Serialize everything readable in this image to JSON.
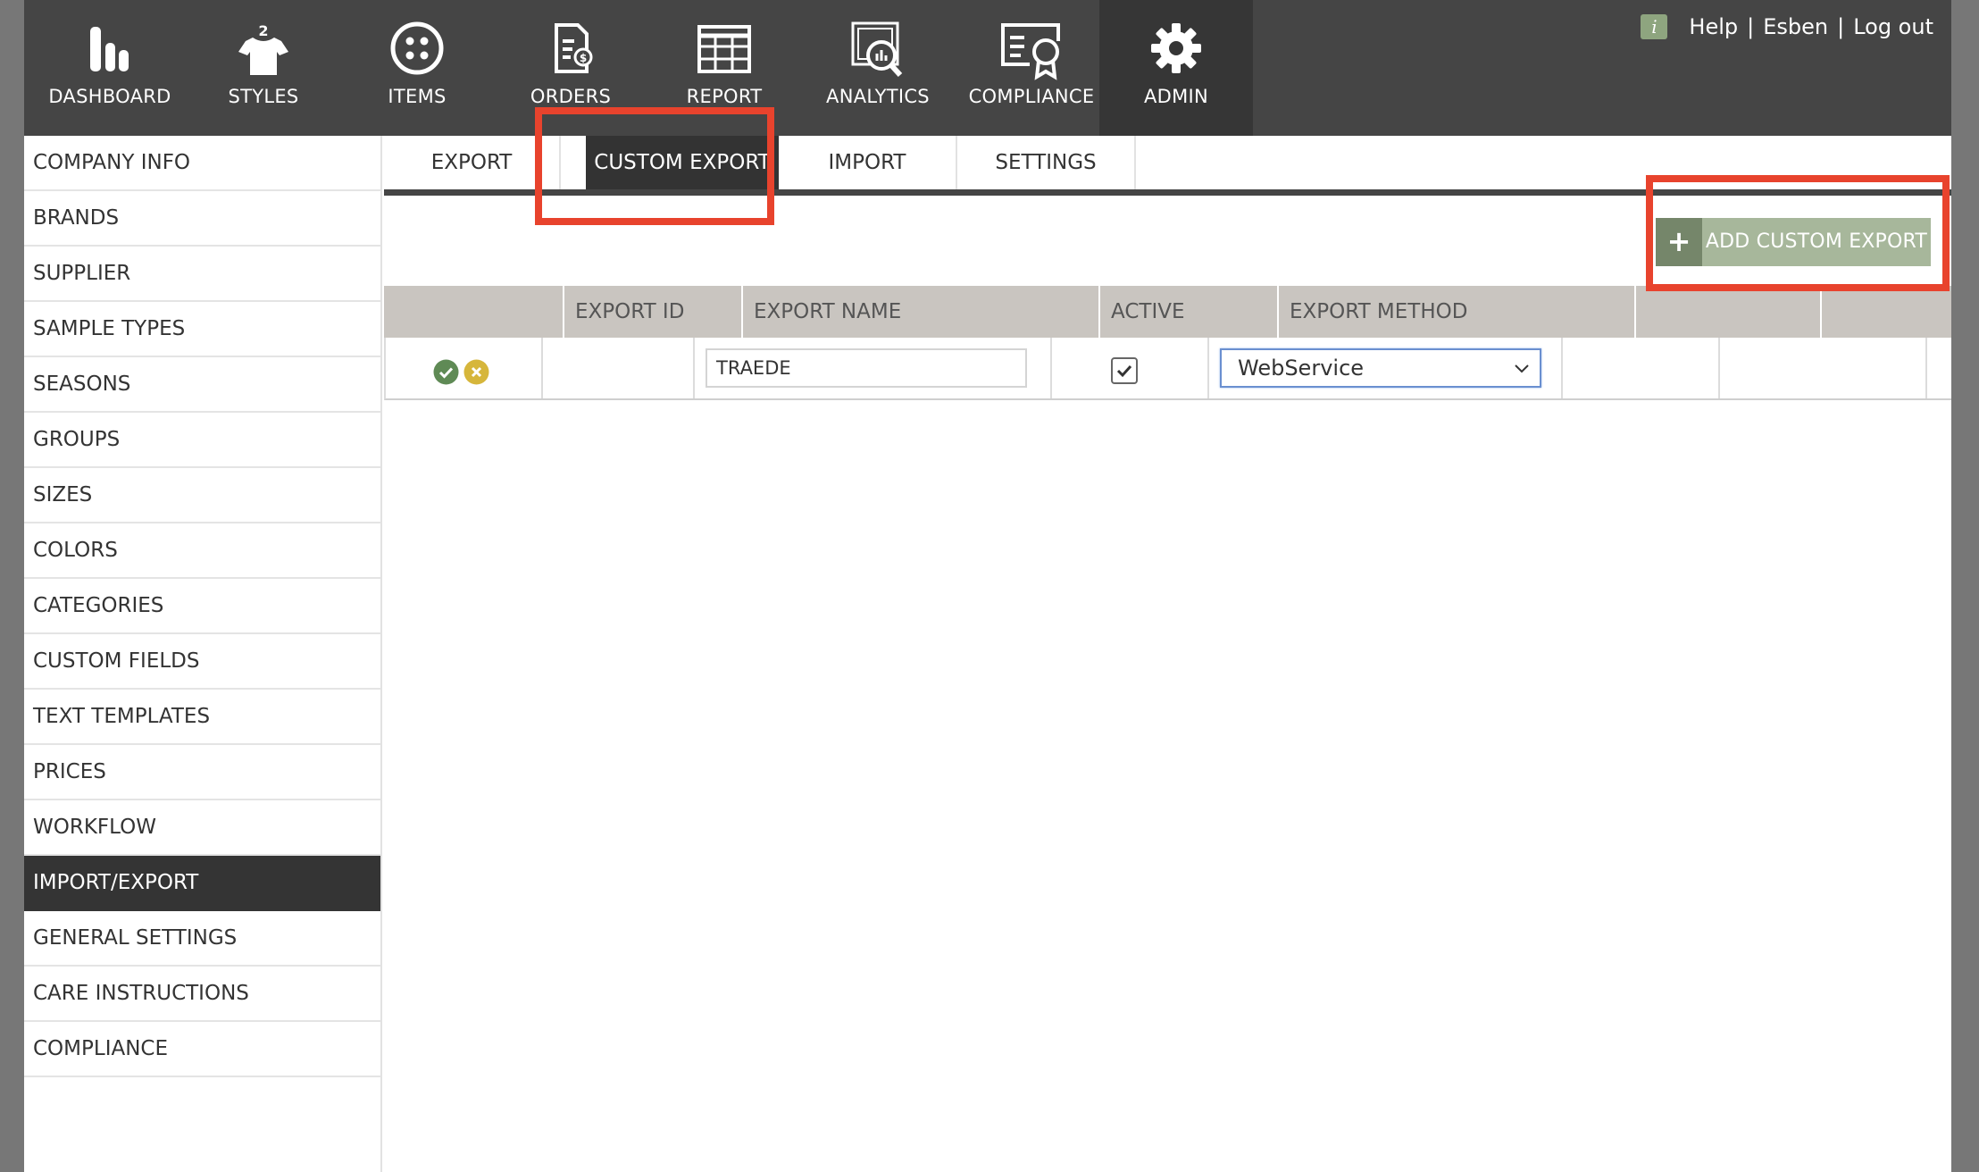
{
  "nav": {
    "items": [
      {
        "label": "DASHBOARD",
        "icon": "bar-chart-icon"
      },
      {
        "label": "STYLES",
        "icon": "tshirt-icon"
      },
      {
        "label": "ITEMS",
        "icon": "button-icon"
      },
      {
        "label": "ORDERS",
        "icon": "invoice-icon"
      },
      {
        "label": "REPORT",
        "icon": "table-grid-icon"
      },
      {
        "label": "ANALYTICS",
        "icon": "magnifier-chart-icon"
      },
      {
        "label": "COMPLIANCE",
        "icon": "certificate-icon"
      },
      {
        "label": "ADMIN",
        "icon": "gear-icon"
      }
    ],
    "active": "ADMIN",
    "info_badge": "i",
    "help": "Help",
    "user": "Esben",
    "logout": "Log out",
    "separator": "|"
  },
  "sidebar": {
    "items": [
      "COMPANY INFO",
      "BRANDS",
      "SUPPLIER",
      "SAMPLE TYPES",
      "SEASONS",
      "GROUPS",
      "SIZES",
      "COLORS",
      "CATEGORIES",
      "CUSTOM FIELDS",
      "TEXT TEMPLATES",
      "PRICES",
      "WORKFLOW",
      "IMPORT/EXPORT",
      "GENERAL SETTINGS",
      "CARE INSTRUCTIONS",
      "COMPLIANCE"
    ],
    "active": "IMPORT/EXPORT"
  },
  "tabs": {
    "items": [
      "EXPORT",
      "CUSTOM EXPORT",
      "IMPORT",
      "SETTINGS"
    ],
    "active": "CUSTOM EXPORT"
  },
  "toolbar": {
    "add_plus": "+",
    "add_label": "ADD CUSTOM EXPORT"
  },
  "table": {
    "headers": [
      "",
      "EXPORT ID",
      "EXPORT NAME",
      "ACTIVE",
      "EXPORT METHOD",
      "",
      ""
    ],
    "rows": [
      {
        "export_id": "",
        "export_name": "TRAEDE",
        "active": true,
        "export_method": "WebService"
      }
    ]
  },
  "colors": {
    "nav_bg": "#454545",
    "nav_active": "#363636",
    "accent_green": "#a7b79b",
    "accent_green_dark": "#75866a",
    "highlight_red": "#e8432d",
    "save_green": "#5f8a55",
    "cancel_yellow": "#d6b63b"
  }
}
